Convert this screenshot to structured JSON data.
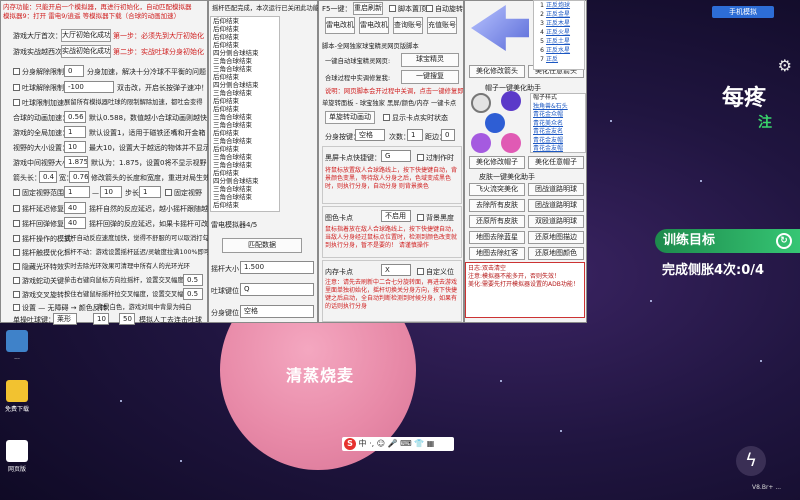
{
  "game": {
    "planet_name": "清蒸烧麦",
    "top_button": "手机模拟",
    "big_text": "每疼",
    "big_text2": "注",
    "training_label": "训练目标",
    "challenge": "完成侧胀4次:0/4",
    "version": "V8.Br+ ..."
  },
  "desktop": {
    "icons": [
      "...",
      "免费下载",
      "网页版"
    ]
  },
  "col1": {
    "title1": "内存功能：只能开启一个模拟器，再进行初始化，自动匹配模拟器",
    "title2": "模拟器9：打开 雷电9/逍遥 等模拟器下载（合球的动画加速）",
    "row_game_label": "游戏大厅首次：",
    "init_game_btn": "大厅初始化成功",
    "step1": "第一步：必须先到大厅初始化",
    "row_ext_label": "游戏实战越西次：",
    "init_battle_btn": "实战初始化成功",
    "step2": "第二步：实战吐球分身初始化",
    "split_label": "分身解除限制：",
    "split_value": "0",
    "split_desc": "分身加速，解决十分冷球不平衡的问题",
    "spit_label": "吐球解除限制：",
    "spit_value": "-100",
    "spit_desc": "双击改，开启长按弹子速冲！",
    "anim_label": "吐球限制加速：",
    "anim_desc": "展留所有模拟器吐球的限制解除加速，都吐会变得",
    "merge_label": "合球的动画加速：",
    "merge_value": "0.56",
    "merge_default": "默认0.588，数值越小合球动画则越快",
    "global_label": "游戏的全局加速：",
    "global_value": "1",
    "global_desc": "默认设置1，适用于磁铁还嘴和开金箱",
    "zoom_label": "视野的大小设置：",
    "zoom_value": "10",
    "zoom_desc": "最大10，设置大于越远的物体并不显示",
    "center_label": "游戏中间视野大小：",
    "center_value": "1.875",
    "center_desc": "默认为：1.875，设置0将不显示视野",
    "arrow_label": "箭头长：",
    "arrow_value": "0.4",
    "arrow_mid": "宽：",
    "arrow_w": "0.76",
    "arrow_desc": "修改箭头的长度和宽度，重进对局生效",
    "fixed_label": "固定视野范围：",
    "fixed_v1": "1",
    "fixed_to": "—",
    "fixed_v2": "10",
    "fixed_step": "步长",
    "fixed_v3": "1",
    "fixed_btn": "固定视野",
    "chk_rows": [
      {
        "label": "摇杆延迟修复：",
        "value": "40",
        "desc": "摇杆自然的反应延迟，越小摇杆跟随越紧"
      },
      {
        "label": "摇杆回弹修复：",
        "value": "40",
        "desc": "摇杆回弹的反应延迟，如果卡摇杆可改10"
      },
      {
        "label": "摇杆操作的模式：",
        "value": "",
        "desc": "摇杆自动反应速度加快，觉得不舒服的可以取消打勾"
      },
      {
        "label": "摇杆触摸优化：",
        "value": "",
        "desc": "摇杆不动：游戏设置摇杆延迟/灵敏度拉满100%即可"
      },
      {
        "label": "隐藏光环特效：",
        "value": "",
        "desc": "实时去除光环效果可清理中所有人的光环光环"
      },
      {
        "label": "游戏蛇动关键：",
        "value": "",
        "desc": "单击右键向鼠标方向拉摇杆，设置交叉幅度："
      },
      {
        "label": "游戏交叉旋转：",
        "value": "",
        "desc": "按住右键鼠标摇杆拉交叉幅度，设置交叉幅度："
      },
      {
        "label": "设置 — 无障碍 → 颜色反转：",
        "value": "",
        "desc": "背景白色，游戏对局中背景为纯白"
      }
    ],
    "cross1": "0.5",
    "cross2": "0.5",
    "bottom_label": "单操吐球键：",
    "bottom_key": "莱形",
    "bottom_min": "10",
    "bottom_max": "50",
    "bottom_desc": "模拟人工去连击吐球"
  },
  "col2": {
    "header": "摇杆匹配完成，本次运行已关闭此功能",
    "list": [
      "后仰结束",
      "后仰结束",
      "后仰结束",
      "后仰结束",
      "四分侧合球结束",
      "三角合球结束",
      "三角合球结束",
      "后仰结束",
      "四分侧合球结束",
      "三角合球结束",
      "后仰结束",
      "后仰结束",
      "三角合球结束",
      "三角合球结束",
      "后仰结束",
      "三角合球结束",
      "后仰结束",
      "三角合球结束",
      "三角合球结束",
      "后仰结束",
      "四分侧合球结束",
      "三角合球结束",
      "三角合球结束",
      "后仰结束"
    ],
    "simulator_label": "雷电模拟器4/5",
    "match_btn": "匹配数据",
    "size_label": "摇杆大小",
    "size_value": "1.500",
    "spit_key_label": "吐球键位",
    "spit_key_value": "Q",
    "split_key_label": "分身键位",
    "split_key_value": "空格"
  },
  "col3": {
    "f5_label": "F5一键：",
    "restart_btn": "重启刷新",
    "script_chk": "脚本置顶",
    "auto_chk": "自动旋转",
    "btns": [
      "雷电改机",
      "雷电改机",
      "查询账号",
      "充值账号"
    ],
    "section_title": "脚本-全网独家球宝精灵网页版脚本",
    "auto_label": "一键自动球宝精灵网页:",
    "auto_btn": "球宝精灵",
    "close_label": "合球过程中实调修复我:",
    "close_btn": "一键搜复",
    "note_red": "说明：网页脚本会开过程中关调，点击一键修复即可",
    "dash_title": "单旋转面板 - 球宝独家 黑屏/颜色/内存 一键卡点",
    "single_btn": "单旋转动画动",
    "show_chk": "显示卡点实时状态",
    "split_key_label": "分身按键：",
    "split_key": "空格",
    "count_label": "次数：",
    "count": "1",
    "dist_label": "距边：",
    "dist": "0",
    "black_label": "黑屏卡点",
    "black_hotkey_label": "快捷键：",
    "black_key": "G",
    "black_chk": "过制作时",
    "black_desc": "将鼠标放置敌人合球路线上，按下快捷键自动，背景颜色变黑，等待敌人分身之后，色域变成黑色时，则执行分身，自动分身 则背景换色",
    "color_label": "图色卡点",
    "color_key": "不启用",
    "color_chk": "背景黑度",
    "color_desc": "鼠标指着放在敌人合球路线上，按下快捷键自动，当敌人分身经过鼠标点位置时，检测到颜色改变就到执行分身，暂不是要的！ 请谨慎操作",
    "mem_label": "内存卡点",
    "mem_key": "X",
    "mem_chk": "自定义位",
    "mem_desc": "注意：请先去刷新中二合七分旋转面，再进去游戏里面单独初始化，摇杆切换关分身方向，按下快捷键之后启动，全自动判断检测到时候分身，如果有的话则执行分身"
  },
  "col4": {
    "numbered": [
      {
        "n": "1",
        "t": "正反炮球"
      },
      {
        "n": "2",
        "t": "正反金星"
      },
      {
        "n": "3",
        "t": "正反木星"
      },
      {
        "n": "4",
        "t": "正反火星"
      },
      {
        "n": "5",
        "t": "正反土星"
      },
      {
        "n": "6",
        "t": "正反水星"
      },
      {
        "n": "7",
        "t": "正反"
      }
    ],
    "b1": "美化修改箭头",
    "b2": "美化任意箭头",
    "hat_title": "帽子一键美化助手",
    "hat_list": [
      "帽子样式",
      "独角兽&石头",
      "青花金众帽",
      "青花美众名",
      "青花金友名",
      "青花金友帽",
      "青花金友帽"
    ],
    "b3": "美化修改帽子",
    "b4": "美化任意帽子",
    "skin_title": "皮肤一键美化助手",
    "skin_btns": [
      "飞火流突美化",
      "团战道路明球",
      "去除所有皮肤",
      "团战道路明球",
      "还原所有皮肤",
      "双殴道路明球",
      "地图去除蓝星",
      "还原地图描边",
      "地图去除红客",
      "还原地图颜色"
    ],
    "note": "日志:双击清空\n注意:模拟器不能多开，否则失效！\n美化:需要先打开模拟器设置的ADB功能！"
  },
  "taskbar": {
    "text": "中 ·, ☺ 🎤 ⌨ 👕 ▦"
  }
}
